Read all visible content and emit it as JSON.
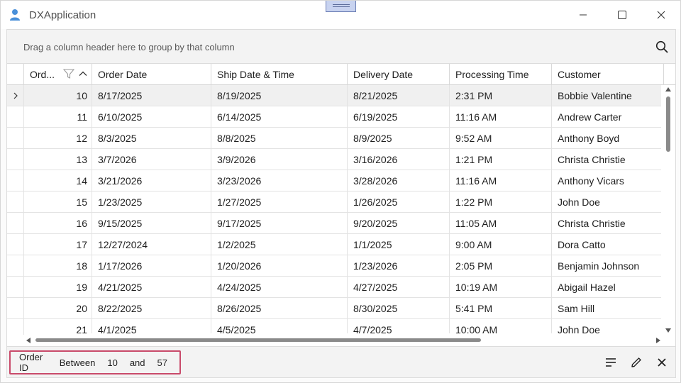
{
  "window": {
    "title": "DXApplication"
  },
  "group_panel": {
    "hint": "Drag a column header here to group by that column"
  },
  "columns": [
    {
      "key": "order_id",
      "label": "Ord..."
    },
    {
      "key": "order_date",
      "label": "Order Date"
    },
    {
      "key": "ship_date",
      "label": "Ship Date & Time"
    },
    {
      "key": "delivery_date",
      "label": "Delivery Date"
    },
    {
      "key": "processing_time",
      "label": "Processing Time"
    },
    {
      "key": "customer",
      "label": "Customer"
    }
  ],
  "rows": [
    {
      "order_id": "10",
      "order_date": "8/17/2025",
      "ship_date": "8/19/2025",
      "delivery_date": "8/21/2025",
      "processing_time": "2:31 PM",
      "customer": "Bobbie Valentine",
      "focused": true
    },
    {
      "order_id": "11",
      "order_date": "6/10/2025",
      "ship_date": "6/14/2025",
      "delivery_date": "6/19/2025",
      "processing_time": "11:16 AM",
      "customer": "Andrew Carter"
    },
    {
      "order_id": "12",
      "order_date": "8/3/2025",
      "ship_date": "8/8/2025",
      "delivery_date": "8/9/2025",
      "processing_time": "9:52 AM",
      "customer": "Anthony Boyd"
    },
    {
      "order_id": "13",
      "order_date": "3/7/2026",
      "ship_date": "3/9/2026",
      "delivery_date": "3/16/2026",
      "processing_time": "1:21 PM",
      "customer": "Christa Christie"
    },
    {
      "order_id": "14",
      "order_date": "3/21/2026",
      "ship_date": "3/23/2026",
      "delivery_date": "3/28/2026",
      "processing_time": "11:16 AM",
      "customer": "Anthony Vicars"
    },
    {
      "order_id": "15",
      "order_date": "1/23/2025",
      "ship_date": "1/27/2025",
      "delivery_date": "1/26/2025",
      "processing_time": "1:22 PM",
      "customer": "John Doe"
    },
    {
      "order_id": "16",
      "order_date": "9/15/2025",
      "ship_date": "9/17/2025",
      "delivery_date": "9/20/2025",
      "processing_time": "11:05 AM",
      "customer": "Christa Christie"
    },
    {
      "order_id": "17",
      "order_date": "12/27/2024",
      "ship_date": "1/2/2025",
      "delivery_date": "1/1/2025",
      "processing_time": "9:00 AM",
      "customer": "Dora Catto"
    },
    {
      "order_id": "18",
      "order_date": "1/17/2026",
      "ship_date": "1/20/2026",
      "delivery_date": "1/23/2026",
      "processing_time": "2:05 PM",
      "customer": "Benjamin Johnson"
    },
    {
      "order_id": "19",
      "order_date": "4/21/2025",
      "ship_date": "4/24/2025",
      "delivery_date": "4/27/2025",
      "processing_time": "10:19 AM",
      "customer": "Abigail Hazel"
    },
    {
      "order_id": "20",
      "order_date": "8/22/2025",
      "ship_date": "8/26/2025",
      "delivery_date": "8/30/2025",
      "processing_time": "5:41 PM",
      "customer": "Sam Hill"
    },
    {
      "order_id": "21",
      "order_date": "4/1/2025",
      "ship_date": "4/5/2025",
      "delivery_date": "4/7/2025",
      "processing_time": "10:00 AM",
      "customer": "John Doe"
    }
  ],
  "filter": {
    "field": "Order ID",
    "operator": "Between",
    "from": "10",
    "conj": "and",
    "to": "57"
  },
  "colors": {
    "accent": "#c94a6a",
    "user_icon": "#4a90d9"
  }
}
